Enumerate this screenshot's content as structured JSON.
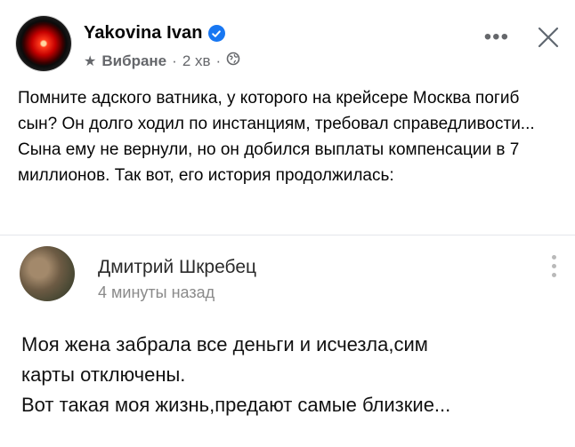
{
  "post": {
    "author": "Yakovina Ivan",
    "feed_label": "Вибране",
    "separator": "·",
    "time": "2 хв",
    "audience_icon": "globe-icon",
    "more_label": "•••",
    "close_icon": "close-icon",
    "text": "Помните адского ватника, у которого на крейсере Москва погиб сын? Он долго ходил по инстанциям, требовал справедливости... Сына ему не вернули, но он добился выплаты компенсации в 7 миллионов. Так вот, его история продолжилась:"
  },
  "comment": {
    "author": "Дмитрий Шкребец",
    "time": "4 минуты назад",
    "lines": [
      "Моя жена забрала все деньги и исчезла,сим",
      "карты отключены.",
      "Вот такая моя жизнь,предают самые близкие..."
    ]
  },
  "colors": {
    "verified_badge": "#1877f2",
    "meta_text": "#65676b"
  }
}
